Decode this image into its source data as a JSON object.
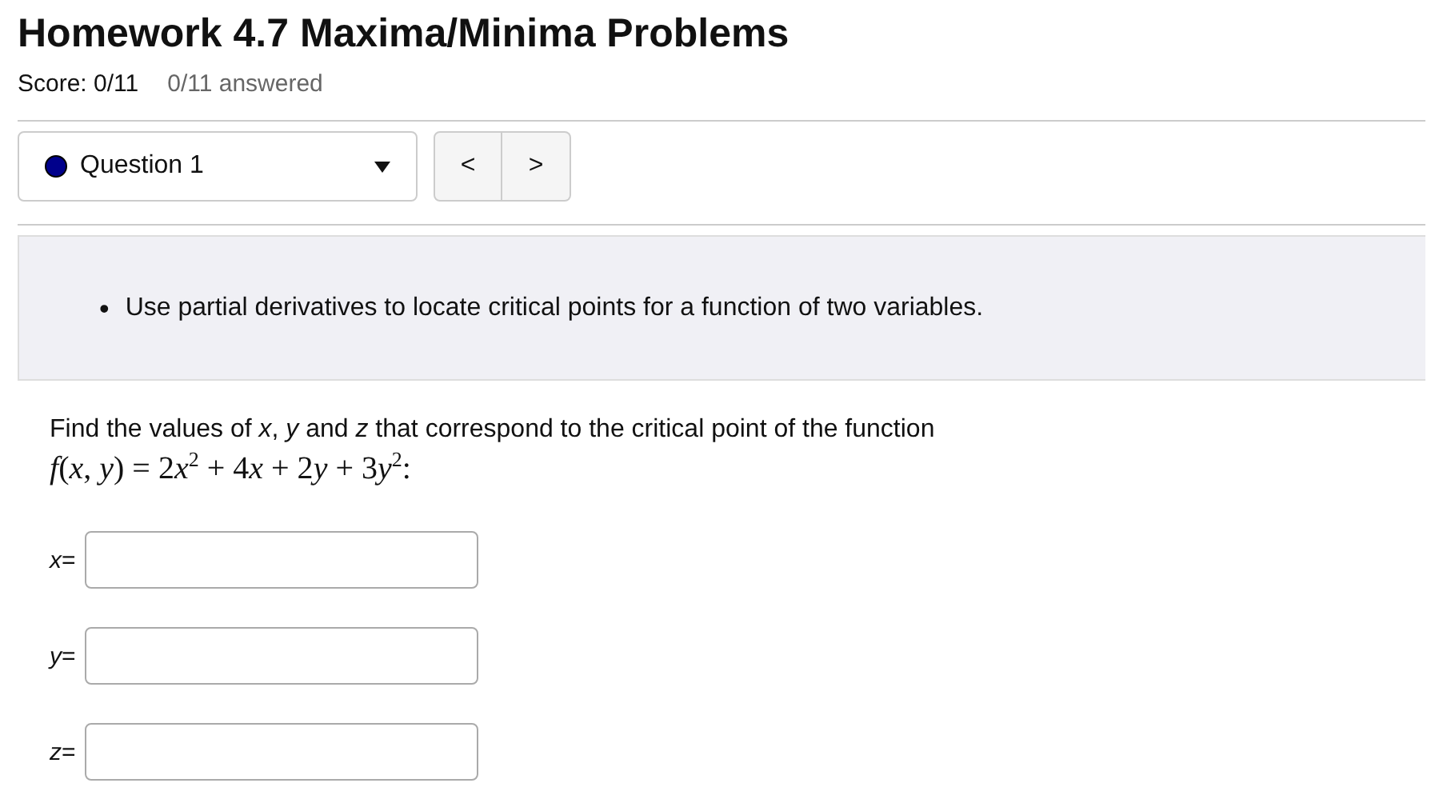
{
  "title": "Homework 4.7 Maxima/Minima Problems",
  "score": "Score: 0/11",
  "answered": "0/11 answered",
  "question_select": {
    "value": "Question 1"
  },
  "nav": {
    "previous": "<",
    "next": ">"
  },
  "objectives": [
    {
      "marker": "•",
      "text": "Use partial derivatives to locate critical points for a function of two variables."
    }
  ],
  "question_text": "Find the values of *x*, *y* and *z* that correspond to the critical point of the function",
  "formula": [
    {
      "kind": "var",
      "text": "f"
    },
    {
      "kind": "text",
      "text": "("
    },
    {
      "kind": "var",
      "text": "x"
    },
    {
      "kind": "text",
      "text": ", "
    },
    {
      "kind": "var",
      "text": "y"
    },
    {
      "kind": "text",
      "text": ") = 2"
    },
    {
      "kind": "var",
      "text": "x"
    },
    {
      "kind": "sup",
      "text": "2"
    },
    {
      "kind": "text",
      "text": " + 4"
    },
    {
      "kind": "var",
      "text": "x"
    },
    {
      "kind": "text",
      "text": " + 2"
    },
    {
      "kind": "var",
      "text": "y"
    },
    {
      "kind": "text",
      "text": " + 3"
    },
    {
      "kind": "var",
      "text": "y"
    },
    {
      "kind": "sup",
      "text": "2"
    },
    {
      "kind": "text",
      "text": ":"
    }
  ],
  "answers": [
    {
      "label": "*x*="
    },
    {
      "label": "*y*="
    },
    {
      "label": "*z*="
    }
  ]
}
